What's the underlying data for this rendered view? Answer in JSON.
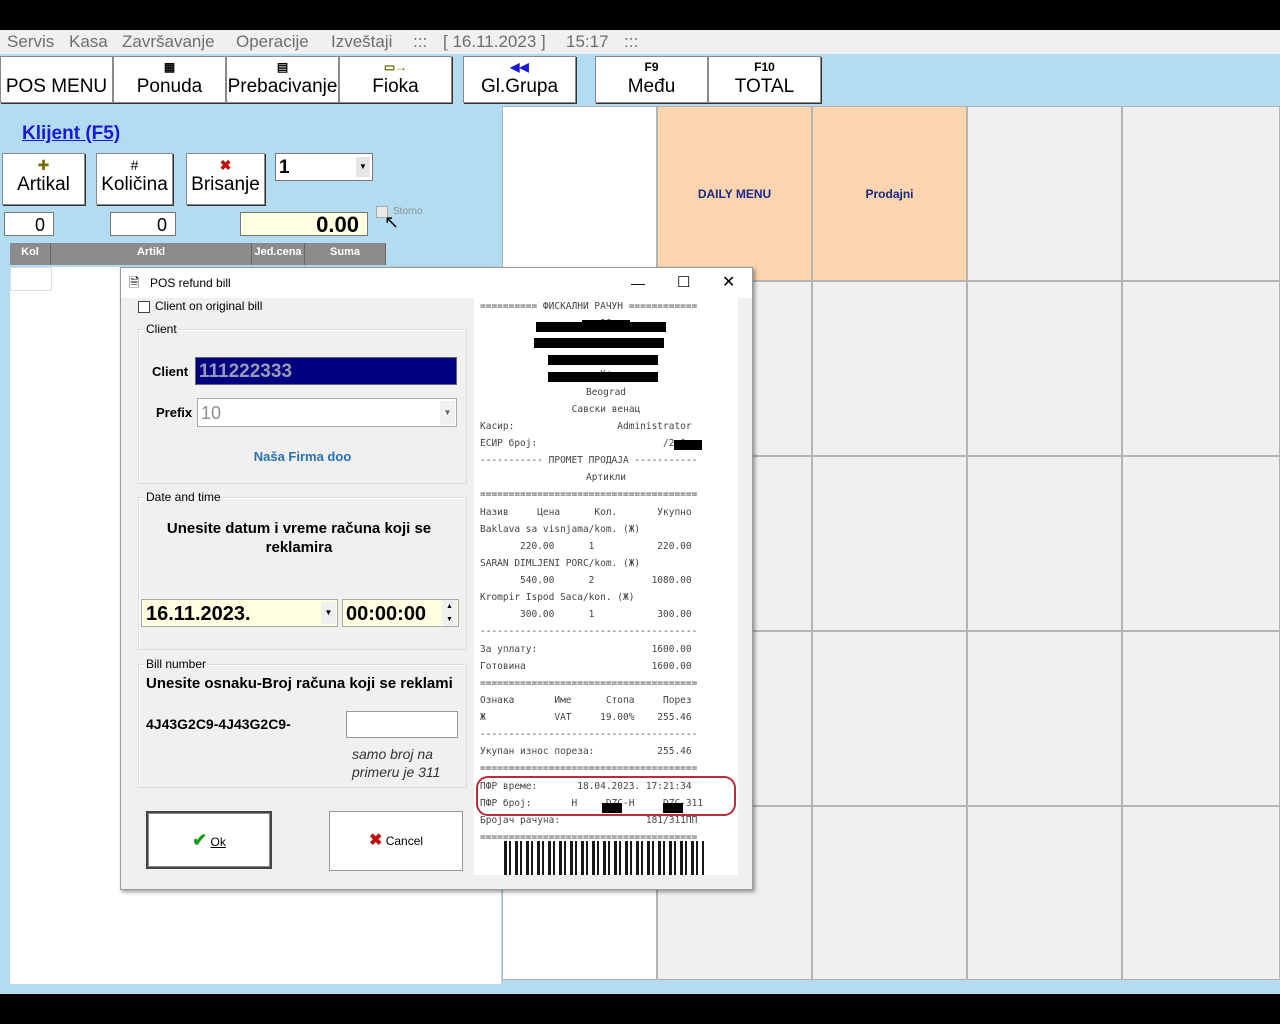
{
  "menubar": {
    "items": [
      "Servis",
      "Kasa",
      "Završavanje",
      "Operacije",
      "Izveštaji",
      ":::",
      "[ 16.11.2023 ]",
      "15:17",
      ":::"
    ]
  },
  "toolbar": {
    "buttons": [
      {
        "label": "POS MENU",
        "icon": ""
      },
      {
        "label": "Ponuda",
        "icon": "menu-doc-icon"
      },
      {
        "label": "Prebacivanje",
        "icon": "transfer-doc-icon"
      },
      {
        "label": "Fioka",
        "icon": "drawer-icon"
      },
      {
        "label": "Gl.Grupa",
        "icon": "rewind-icon"
      },
      {
        "label": "Među",
        "key": "F9"
      },
      {
        "label": "TOTAL",
        "key": "F10"
      }
    ]
  },
  "client_link": "Klijent (F5)",
  "actions": {
    "artikal": "Artikal",
    "kolicina": "Količina",
    "brisanje": "Brisanje",
    "qty_select": "1",
    "storno": "Storno"
  },
  "totals": {
    "a": "0",
    "b": "0",
    "sum": "0.00"
  },
  "grid_headers": [
    "Kol",
    "Artikl",
    "Jed.cena",
    "Suma"
  ],
  "tiles": {
    "daily_menu": "DAILY MENU",
    "prodajni": "Prodajni"
  },
  "dialog": {
    "title": "POS refund bill",
    "client_on_original": "Client on original bill",
    "client_group": "Client",
    "client_label": "Client",
    "client_value": "111222333",
    "prefix_label": "Prefix",
    "prefix_value": "10",
    "firm_name": "Naša Firma doo",
    "datetime_group": "Date and time",
    "datetime_prompt": "Unesite datum i vreme računa koji se reklamira",
    "date_value": "16.11.2023.",
    "time_value": "00:00:00",
    "bill_group": "Bill number",
    "bill_prompt": "Unesite osnaku-Broj računa koji se reklami",
    "bill_prefix": "4J43G2C9-4J43G2C9-",
    "bill_input": "",
    "bill_hint": "samo broj na primeru je 311",
    "ok_label": "Ok",
    "cancel_label": "Cancel"
  },
  "receipt": {
    "lines": [
      "========== ФИСКАЛНИ РАЧУН ============",
      "10",
      "",
      "",
      "Ко",
      "Beograd",
      "Савски венац",
      "Касир:                  Administrator",
      "ЕСИР број:                      /2.0",
      "----------- ПРОМЕТ ПРОДАЈА -----------",
      "Артикли",
      "======================================",
      "Назив     Цена      Кол.       Укупно",
      "Baklava sa visnjama/kom. (Ж)",
      "       220.00      1           220.00",
      "SARAN DIMLJENI PORC/kom. (Ж)",
      "       540.00      2          1080.00",
      "Krompir Ispod Saca/kon. (Ж)",
      "       300.00      1           300.00",
      "--------------------------------------",
      "За уплату:                    1600.00",
      "Готовина                      1600.00",
      "======================================",
      "Ознака       Име      Стопа     Порез",
      "Ж            VAT     19.00%    255.46",
      "--------------------------------------",
      "Укупан износ пореза:           255.46",
      "======================================",
      "ПФР време:       18.04.2023. 17:21:34",
      "ПФР број:       H     DZC-H     DZC-311",
      "Бројач рачуна:               181/311ПП",
      "======================================"
    ]
  }
}
